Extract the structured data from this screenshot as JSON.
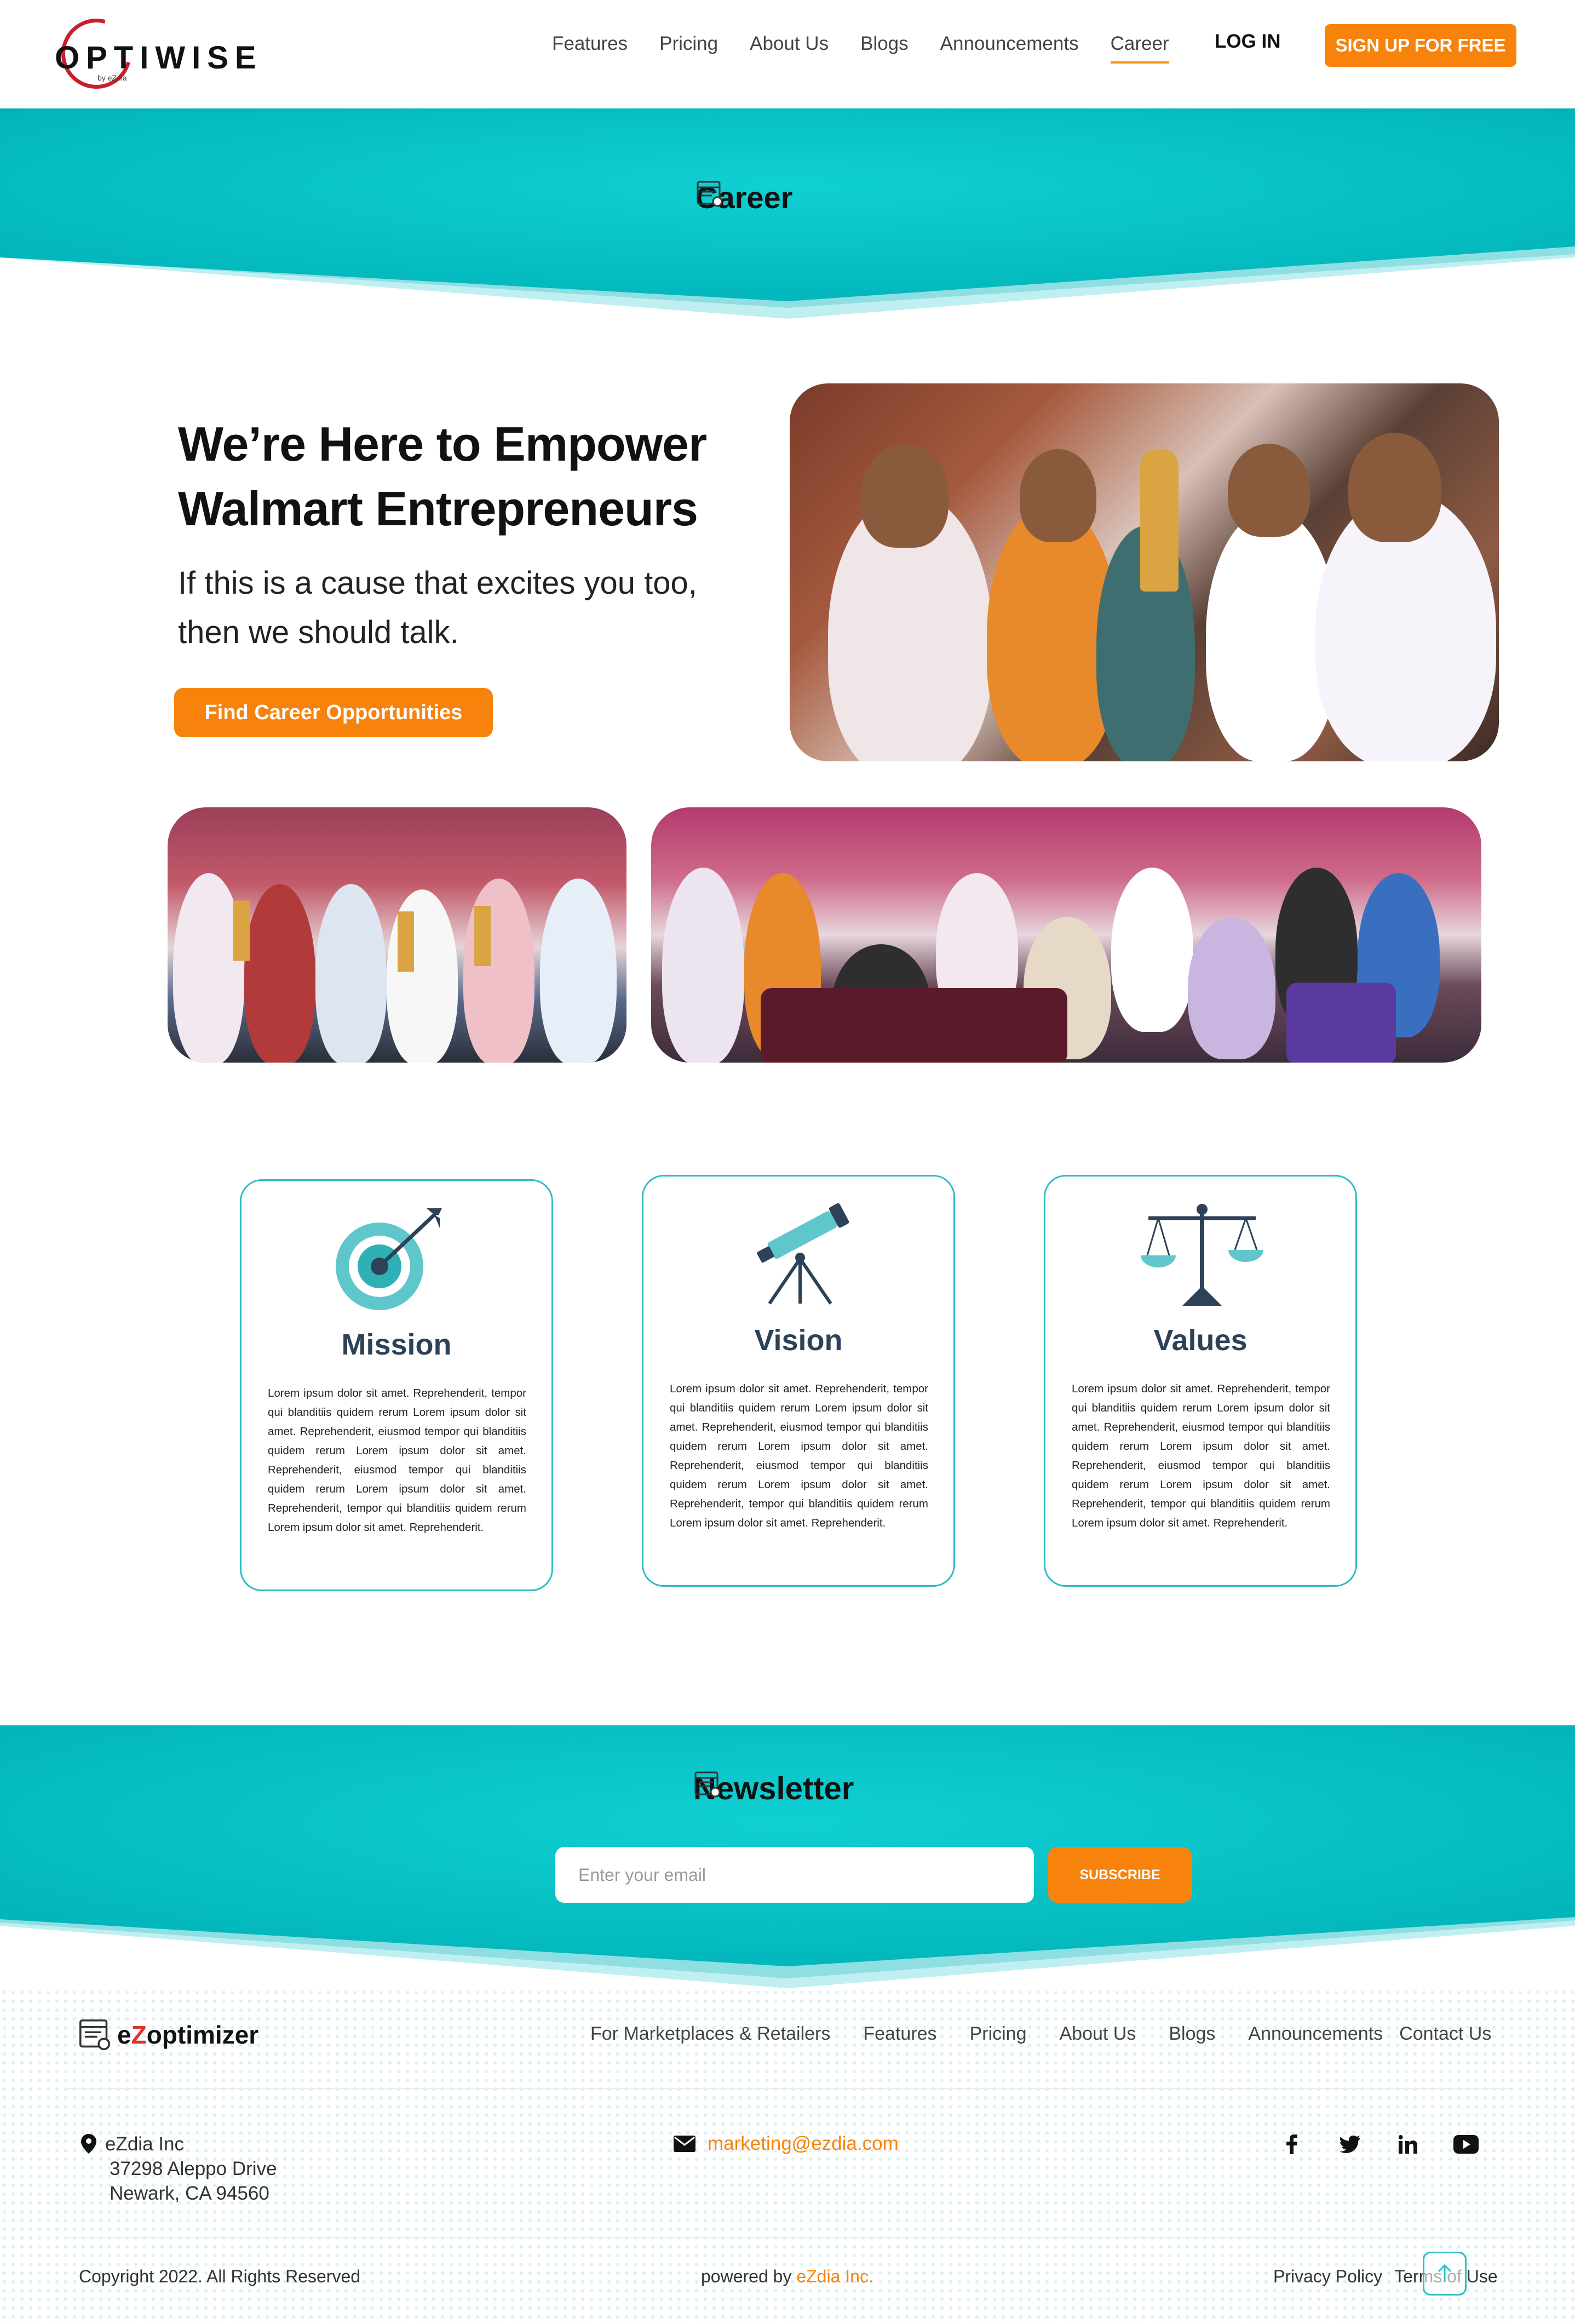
{
  "nav": {
    "brand": "OPTIWISE",
    "brand_sub": "by eZdia",
    "links": [
      "Features",
      "Pricing",
      "About Us",
      "Blogs",
      "Announcements",
      "Career"
    ],
    "active_link": "Career",
    "login": "LOG IN",
    "signup": "SIGN UP FOR FREE"
  },
  "banner": {
    "title": "Career",
    "icon": "document-icon"
  },
  "hero": {
    "heading": "We’re Here to Empower Walmart Entrepreneurs",
    "subtitle": "If this is a cause that excites you too, then we should talk.",
    "button": "Find Career Opportunities"
  },
  "cards": [
    {
      "title": "Mission",
      "icon": "target-icon",
      "body": "Lorem ipsum dolor sit amet. Reprehenderit, tempor qui blanditiis quidem rerum Lorem ipsum dolor sit amet. Reprehenderit, eiusmod tempor qui blanditiis quidem rerum Lorem ipsum dolor sit amet. Reprehenderit, eiusmod tempor qui blanditiis quidem rerum Lorem ipsum dolor sit amet. Reprehenderit, tempor qui blanditiis quidem rerum Lorem ipsum dolor sit amet. Reprehenderit."
    },
    {
      "title": "Vision",
      "icon": "telescope-icon",
      "body": "Lorem ipsum dolor sit amet. Reprehenderit, tempor qui blanditiis quidem rerum Lorem ipsum dolor sit amet. Reprehenderit, eiusmod tempor qui blanditiis quidem rerum Lorem ipsum dolor sit amet. Reprehenderit, eiusmod tempor qui blanditiis quidem rerum Lorem ipsum dolor sit amet. Reprehenderit, tempor qui blanditiis quidem rerum Lorem ipsum dolor sit amet. Reprehenderit."
    },
    {
      "title": "Values",
      "icon": "scales-icon",
      "body": "Lorem ipsum dolor sit amet. Reprehenderit, tempor qui blanditiis quidem rerum Lorem ipsum dolor sit amet. Reprehenderit, eiusmod tempor qui blanditiis quidem rerum Lorem ipsum dolor sit amet. Reprehenderit, eiusmod tempor qui blanditiis quidem rerum Lorem ipsum dolor sit amet. Reprehenderit, tempor qui blanditiis quidem rerum Lorem ipsum dolor sit amet. Reprehenderit."
    }
  ],
  "newsletter": {
    "title": "Newsletter",
    "placeholder": "Enter your email",
    "button": "SUBSCRIBE"
  },
  "footer": {
    "brand_prefix": "e",
    "brand_z": "Z",
    "brand_rest": "optimizer",
    "links": [
      "For Marketplaces & Retailers",
      "Features",
      "Pricing",
      "About Us",
      "Blogs",
      "Announcements",
      "Contact Us"
    ],
    "address": {
      "company": "eZdia Inc",
      "street": "37298 Aleppo Drive",
      "city": "Newark, CA 94560"
    },
    "email": "marketing@ezdia.com",
    "social": [
      "facebook-icon",
      "twitter-icon",
      "linkedin-icon",
      "youtube-icon"
    ],
    "copyright": "Copyright 2022. All Rights Reserved",
    "powered_prefix": "powered by ",
    "powered_brand": "eZdia Inc.",
    "privacy": "Privacy Policy",
    "terms": "Terms of Use"
  },
  "colors": {
    "teal": "#00c2c7",
    "orange": "#f7830c",
    "card_border": "#2fbcc4",
    "heading_dark": "#2d4157"
  }
}
